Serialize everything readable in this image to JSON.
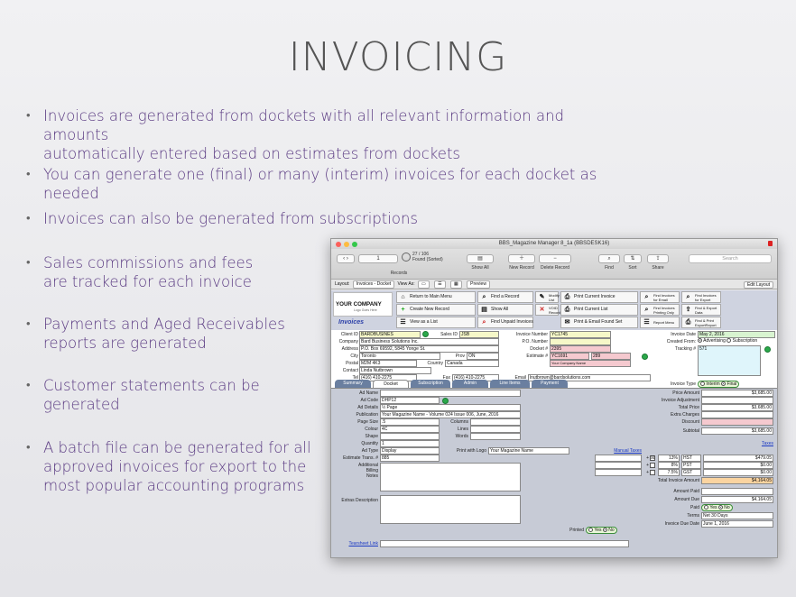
{
  "slide": {
    "title": "INVOICING",
    "bullets": [
      "Invoices are generated from dockets with all relevant information and amounts\nautomatically entered based on estimates from dockets",
      "You can generate one (final) or many (interim) invoices for each docket as needed",
      "Invoices can also be generated from subscriptions",
      "Sales commissions and fees\nare tracked for each invoice",
      "Payments and Aged Receivables\nreports are generated",
      "Customer statements can be\ngenerated",
      "A batch file can be generated for all\napproved invoices for export to the\nmost popular accounting programs"
    ]
  },
  "window": {
    "title": "BBS_Magazine Manager 8_1a (BBSDESK16)",
    "toolbar": {
      "record_number": "1",
      "found": "27 / 106",
      "found_sub": "Found (Sorted)",
      "records_label": "Records",
      "show_all": "Show All",
      "new_record": "New Record",
      "delete_record": "Delete Record",
      "find": "Find",
      "sort": "Sort",
      "share": "Share",
      "search_placeholder": "Search"
    },
    "layoutbar": {
      "layout_label": "Layout:",
      "layout_value": "Invoices - Docket",
      "view_as": "View As:",
      "preview": "Preview",
      "edit_layout": "Edit Layout"
    },
    "header": {
      "logo_main": "YOUR COMPANY",
      "logo_sub": "Logo Goes Here",
      "section_title": "Invoices",
      "buttons": {
        "return_main": "Return to Main Menu",
        "create_new": "Create New Record",
        "view_list": "View as a List",
        "find_record": "Find a Record",
        "show_all": "Show All",
        "find_unpaid": "Find Unpaid Invoices",
        "modify_list": "Modify\nList",
        "void_record": "VOID\nRecord",
        "print_current_invoice": "Print Current Invoice",
        "print_current_list": "Print Current List",
        "print_email_found": "Print & Email Found Set",
        "find_invoices_email": "Find Invoices\nfor Email",
        "find_invoices_printing": "Find Invoices\nPrinting Only",
        "report_menu": "Report  Menu",
        "find_invoices_export": "Find Invoices\nfor Export",
        "find_export_data": "Find & Export\nData",
        "find_print_export_report": "Find & Print\nExportReport"
      }
    },
    "client": {
      "client_id_label": "Client ID",
      "client_id": "BARDBUSINES",
      "sales_id_label": "Sales ID",
      "sales_id": "JSB",
      "company_label": "Company",
      "company": "Bard Business Solutions Inc.",
      "address_label": "Address",
      "address": "P.O. Box 69592, 5845 Yonge St.",
      "city_label": "City",
      "city": "Toronto",
      "prov_label": "Prov",
      "prov": "ON",
      "postal_label": "Postal",
      "postal": "M2M 4K3",
      "country_label": "Country",
      "country": "Canada",
      "contact_label": "Contact",
      "contact": "Linda Nutbrown",
      "tel_label": "Tel",
      "tel": "(416) 410-2275",
      "fax_label": "Fax",
      "fax": "(416) 410-2275"
    },
    "invoice": {
      "invoice_number_label": "Invoice Number",
      "invoice_number": "YC1745",
      "po_label": "P.O. Number",
      "po": "",
      "docket_label": "Docket #",
      "docket": "2395",
      "estimate_label": "Estimate #",
      "estimate": "YC1691",
      "estimate_ref": "289",
      "company_name_placeholder": "Your Company Name",
      "email_label": "Email",
      "email": "lnutbrown@bardsolutions.com",
      "invoice_date_label": "Invoice Date",
      "invoice_date": "May 2, 2016",
      "created_from_label": "Created From:",
      "created_from_advertising": "Advertising",
      "created_from_subscription": "Subscription",
      "tracking_label": "Tracking #",
      "tracking": "571",
      "invoice_type_label": "Invoice Type",
      "invoice_type_interim": "Interim",
      "invoice_type_final": "Final"
    },
    "tabs": [
      "Summary",
      "Docket",
      "Subscription",
      "Admin",
      "Line Items",
      "Payment"
    ],
    "docket": {
      "ad_name_label": "Ad Name",
      "ad_code_label": "Ad Code",
      "ad_code": "DHP12",
      "ad_details_label": "Ad Details",
      "ad_details": "½ Page",
      "publication_label": "Publication",
      "publication": "Your Magazine Name - Volume 024 Issue 006, June, 2016",
      "page_size_label": "Page Size",
      "page_size": ".5",
      "columns_label": "Columns",
      "colour_label": "Colour",
      "colour": "4C",
      "lines_label": "Lines",
      "shape_label": "Shape",
      "words_label": "Words",
      "quantity_label": "Quantity",
      "quantity": "1",
      "ad_type_label": "Ad Type",
      "ad_type": "Display",
      "print_logo_label": "Print with Logo",
      "print_logo": "Your Magazine Name",
      "estimate_trans_label": "Estimate Trans. #",
      "estimate_trans": "885",
      "billing_notes_label": "Additional\nBilling\nNotes",
      "extras_label": "Extras Description",
      "printed_label": "Printed",
      "printed_yes": "Yes",
      "printed_no": "No",
      "tearsheet_label": "Tearsheet Link"
    },
    "totals": {
      "price_amount_label": "Price Amount",
      "price_amount": "$3,685.00",
      "invoice_adjustment_label": "Invoice Adjustment",
      "total_price_label": "Total Price",
      "total_price": "$3,685.00",
      "extra_charges_label": "Extra Charges",
      "discount_label": "Discount",
      "subtotal_label": "Subtotal",
      "subtotal": "$3,685.00",
      "manual_taxes_label": "Manual Taxes",
      "taxes_label": "Taxes",
      "tax_rows": [
        {
          "checked": "☒",
          "rate": "13%",
          "name": "HST",
          "amount": "$479.05"
        },
        {
          "checked": "",
          "rate": "8%",
          "name": "PST",
          "amount": "$0.00"
        },
        {
          "checked": "",
          "rate": "7.5%",
          "name": "GST",
          "amount": "$0.00"
        }
      ],
      "total_invoice_label": "Total Invoice Amount",
      "total_invoice": "$4,164.05",
      "amount_paid_label": "Amount Paid",
      "amount_due_label": "Amount Due",
      "amount_due": "$4,164.05",
      "paid_label": "Paid",
      "paid_yes": "Yes",
      "paid_no": "No",
      "terms_label": "Terms",
      "terms": "Net 30 Days",
      "due_date_label": "Invoice Due Date",
      "due_date": "June 1, 2016"
    }
  }
}
